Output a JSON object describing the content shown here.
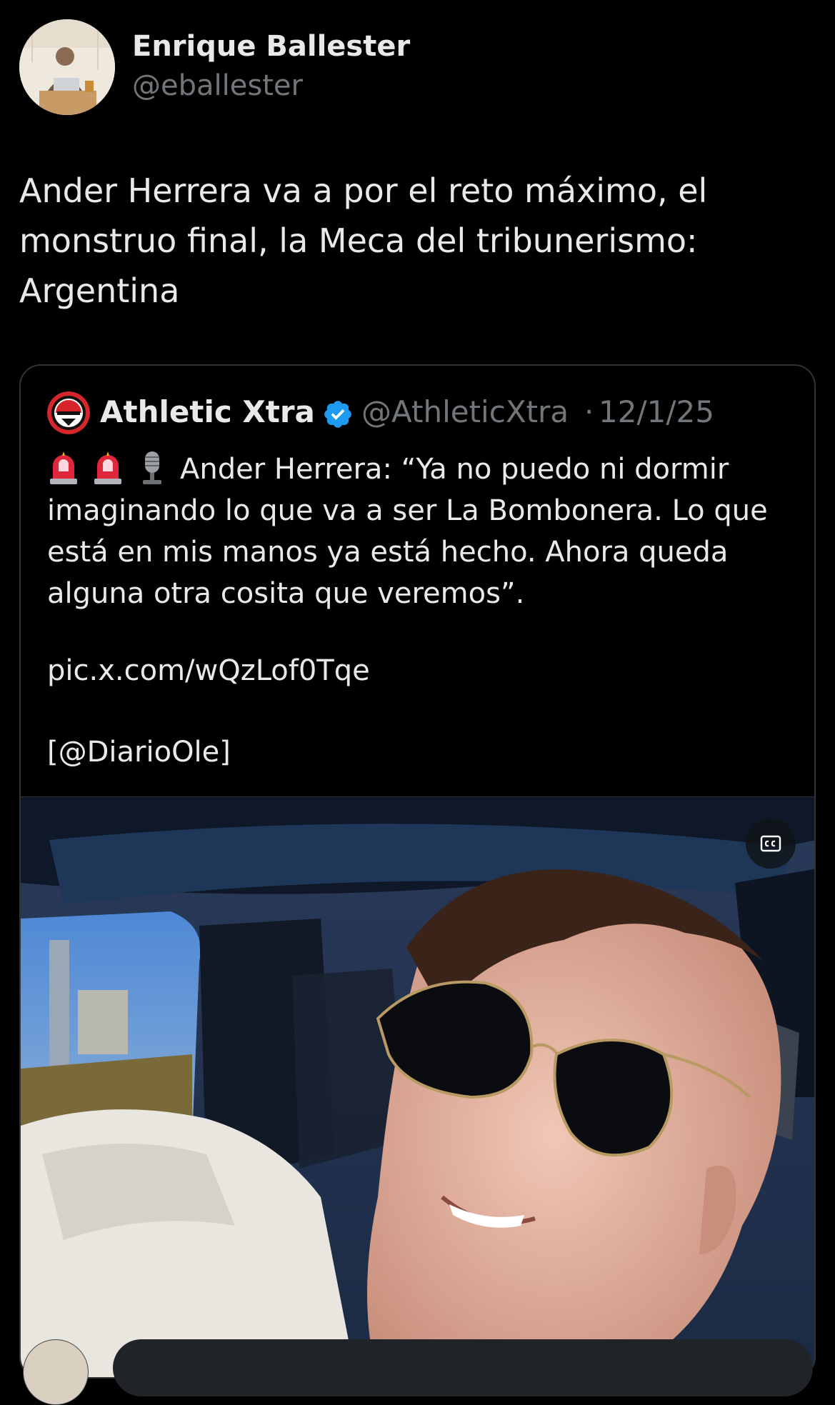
{
  "author": {
    "name": "Enrique Ballester",
    "handle": "@eballester",
    "avatar_icon": "profile-photo"
  },
  "post": {
    "lines": [
      "Ander Herrera va a por el reto máximo, el",
      "monstruo final, la Meca del tribunerismo:",
      "Argentina"
    ]
  },
  "quoted": {
    "name": "Athletic Xtra",
    "verified_icon": "verified-badge-icon",
    "handle": "@AthleticXtra",
    "separator": "·",
    "date": "12/1/25",
    "emojis": [
      "police-light-icon",
      "police-light-icon",
      "microphone-icon"
    ],
    "text_lines": [
      "Ander Herrera: “Ya no puedo ni dormir",
      "imaginando lo que va a ser La Bombonera. Lo que",
      "está en mis manos ya está hecho. Ahora queda",
      "alguna otra cosita que veremos”."
    ],
    "link": "pic.x.com/wQzLof0Tqe",
    "credit": "[@DiarioOle]"
  },
  "media": {
    "type": "video",
    "caption_button_icon": "closed-captions-icon"
  },
  "colors": {
    "background": "#000000",
    "text": "#e7e9ea",
    "muted": "#71767b",
    "border": "#2f3336",
    "verified": "#1d9bf0"
  }
}
